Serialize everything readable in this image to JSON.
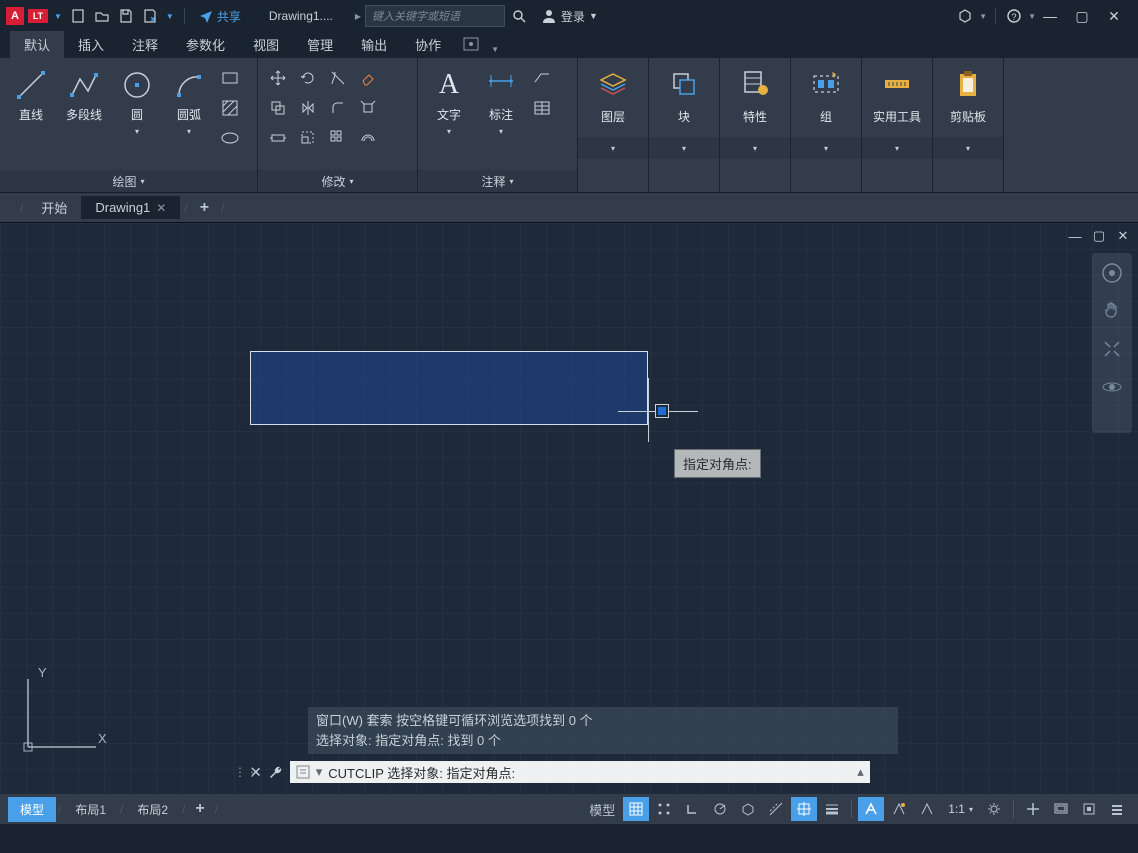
{
  "titlebar": {
    "lt": "LT",
    "share": "共享",
    "doc": "Drawing1....",
    "search_placeholder": "键入关键字或短语",
    "login": "登录",
    "arrow": "▸"
  },
  "menu": {
    "tabs": [
      "默认",
      "插入",
      "注释",
      "参数化",
      "视图",
      "管理",
      "输出",
      "协作"
    ]
  },
  "ribbon": {
    "draw": {
      "title": "绘图",
      "line": "直线",
      "pline": "多段线",
      "circle": "圆",
      "arc": "圆弧"
    },
    "modify": {
      "title": "修改"
    },
    "annot": {
      "title": "注释",
      "text": "文字",
      "dim": "标注"
    },
    "panels": {
      "layers": "图层",
      "block": "块",
      "props": "特性",
      "group": "组",
      "util": "实用工具",
      "clip": "剪贴板"
    }
  },
  "filetabs": {
    "start": "开始",
    "drawing": "Drawing1"
  },
  "canvas": {
    "tooltip": "指定对角点:",
    "ucs_y": "Y",
    "ucs_x": "X"
  },
  "cmd": {
    "hist1": "窗口(W) 套索  按空格键可循环浏览选项找到 0 个",
    "hist2": "选择对象: 指定对角点: 找到 0 个",
    "prompt": "CUTCLIP 选择对象: 指定对角点:",
    "caret": "▾"
  },
  "status": {
    "model": "模型",
    "layout1": "布局1",
    "layout2": "布局2",
    "model_btn": "模型",
    "scale": "1:1"
  }
}
